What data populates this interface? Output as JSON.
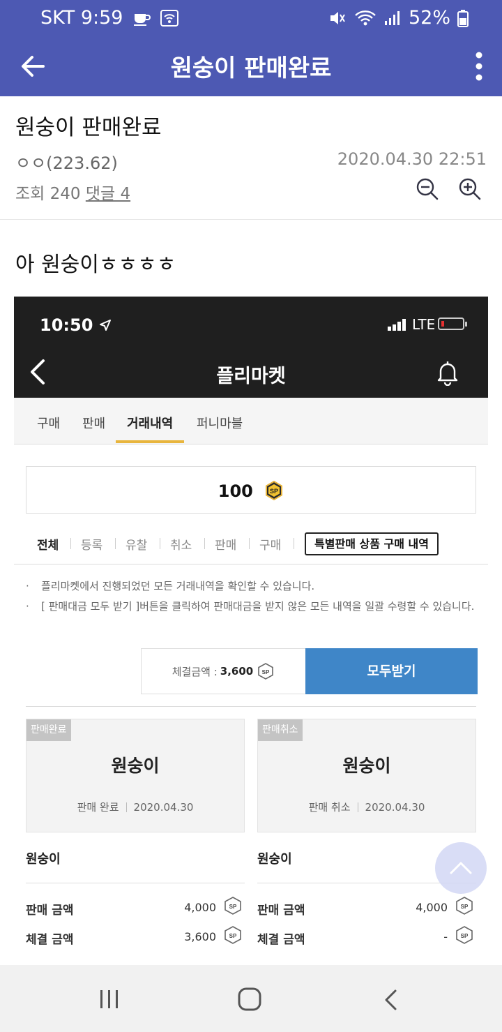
{
  "statusbar": {
    "carrier_time": "SKT 9:59",
    "battery": "52%"
  },
  "appbar": {
    "title": "원숭이 판매완료"
  },
  "post": {
    "title": "원숭이 판매완료",
    "author": "ㅇㅇ(223.62)",
    "datetime": "2020.04.30 22:51",
    "views": "조회 240",
    "comments": "댓글 4",
    "body": "아 원숭이ㅎㅎㅎㅎ"
  },
  "embedded": {
    "time": "10:50",
    "network": "LTE",
    "title": "플리마켓",
    "tabs": [
      "구매",
      "판매",
      "거래내역",
      "퍼니마블"
    ],
    "active_tab": "거래내역",
    "balance": "100",
    "coin_gold_label": "SP",
    "filters": [
      "전체",
      "등록",
      "유찰",
      "취소",
      "판매",
      "구매"
    ],
    "active_filter": "전체",
    "special_button": "특별판매 상품 구매 내역",
    "notes": [
      "플리마켓에서 진행되었던 모든 거래내역을 확인할 수 있습니다.",
      "[ 판매대금 모두 받기 ]버튼을 클릭하여 판매대금을 받지 않은 모든 내역을 일괄 수령할 수 있습니다."
    ],
    "total_label": "체결금액 :",
    "total_value": "3,600",
    "all_button": "모두받기",
    "sp_label": "SP",
    "cards": [
      {
        "badge": "판매완료",
        "name": "원숭이",
        "status": "판매 완료",
        "date": "2020.04.30",
        "item": "원숭이",
        "sale_label": "판매 금액",
        "sale_value": "4,000",
        "deal_label": "체결 금액",
        "deal_value": "3,600"
      },
      {
        "badge": "판매취소",
        "name": "원숭이",
        "status": "판매 취소",
        "date": "2020.04.30",
        "item": "원숭이",
        "sale_label": "판매 금액",
        "sale_value": "4,000",
        "deal_label": "체결 금액",
        "deal_value": "-"
      }
    ]
  },
  "colors": {
    "appbar": "#4d59b3",
    "accent_tab": "#e8b53d",
    "button_blue": "#3f86c8",
    "embedded_header": "#1f1f1f"
  }
}
